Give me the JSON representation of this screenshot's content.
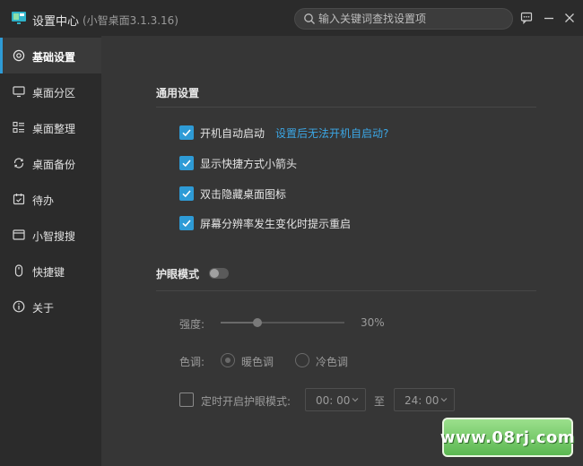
{
  "window": {
    "title": "设置中心",
    "version": "(小智桌面3.1.3.16)",
    "search_placeholder": "输入关键词查找设置项"
  },
  "icons": {
    "logo": "monitor-logo-icon",
    "search": "search-icon",
    "feedback": "feedback-icon",
    "minimize": "minimize-icon",
    "close": "close-icon"
  },
  "sidebar": {
    "items": [
      {
        "label": "基础设置",
        "icon": "gear-icon",
        "active": true
      },
      {
        "label": "桌面分区",
        "icon": "monitor-icon",
        "active": false
      },
      {
        "label": "桌面整理",
        "icon": "organize-icon",
        "active": false
      },
      {
        "label": "桌面备份",
        "icon": "backup-icon",
        "active": false
      },
      {
        "label": "待办",
        "icon": "calendar-icon",
        "active": false
      },
      {
        "label": "小智搜搜",
        "icon": "window-icon",
        "active": false
      },
      {
        "label": "快捷键",
        "icon": "mouse-icon",
        "active": false
      },
      {
        "label": "关于",
        "icon": "info-icon",
        "active": false
      }
    ]
  },
  "general": {
    "title": "通用设置",
    "options": [
      {
        "label": "开机自动启动",
        "checked": true
      },
      {
        "label": "显示快捷方式小箭头",
        "checked": true
      },
      {
        "label": "双击隐藏桌面图标",
        "checked": true
      },
      {
        "label": "屏幕分辨率发生变化时提示重启",
        "checked": true
      }
    ],
    "help_link": "设置后无法开机自启动?"
  },
  "eye_care": {
    "title": "护眼模式",
    "enabled": false,
    "intensity_label": "强度:",
    "intensity_value": "30%",
    "intensity_fraction": 0.3,
    "tone_label": "色调:",
    "tone_warm": "暖色调",
    "tone_cool": "冷色调",
    "selected_tone": "warm",
    "schedule_label": "定时开启护眼模式:",
    "schedule_enabled": false,
    "start_time": "00: 00",
    "to_label": "至",
    "end_time": "24: 00"
  },
  "colors": {
    "accent": "#2e9bd6",
    "link": "#3ba7e6",
    "sidebar_bg": "#2b2b2b",
    "content_bg": "#363636"
  },
  "watermark": {
    "text": "www.08rj.com"
  }
}
